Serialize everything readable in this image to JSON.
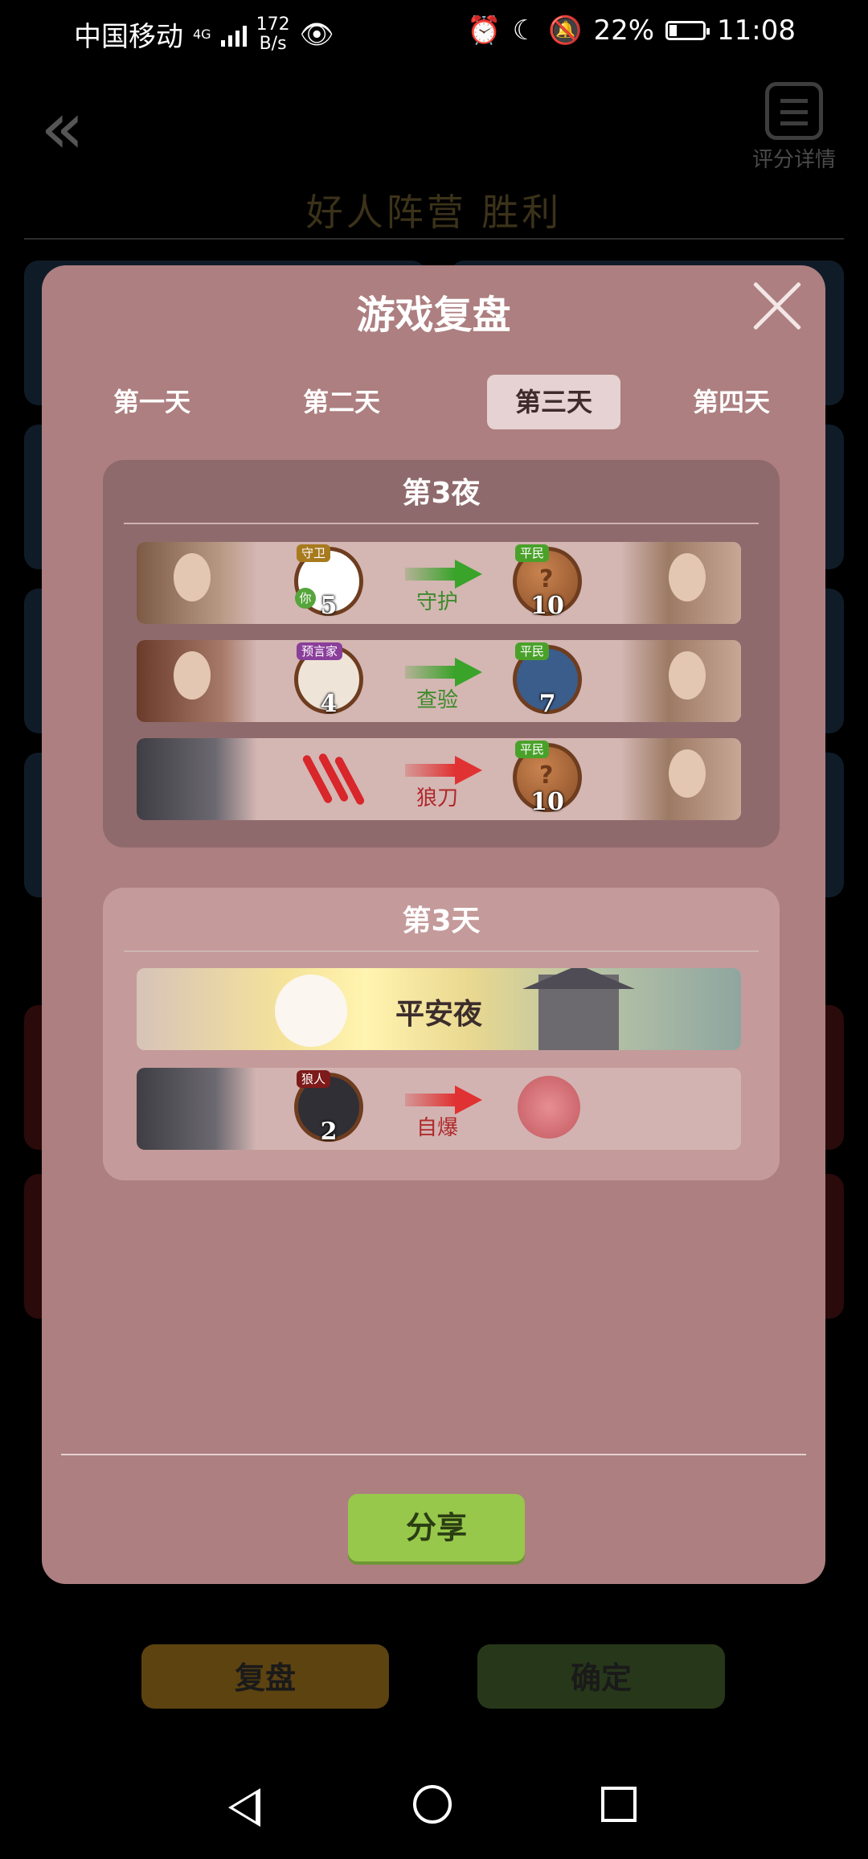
{
  "status_bar": {
    "carrier": "中国移动",
    "network": "4G",
    "speed_value": "172",
    "speed_unit": "B/s",
    "battery": "22%",
    "time": "11:08",
    "battery_fraction": 0.22
  },
  "background": {
    "result_title": "好人阵营  胜利",
    "score_detail_label": "评分详情",
    "review_button": "复盘",
    "confirm_button": "确定"
  },
  "modal": {
    "title": "游戏复盘",
    "tabs": [
      "第一天",
      "第二天",
      "第三天",
      "第四天"
    ],
    "active_tab": 2,
    "night": {
      "title": "第3夜",
      "rows": [
        {
          "actor_role": "守卫",
          "actor_num": "5",
          "actor_you": "你",
          "action": "守护",
          "target_role": "平民",
          "target_num": "10"
        },
        {
          "actor_role": "预言家",
          "actor_num": "4",
          "action": "查验",
          "target_role": "平民",
          "target_num": "7"
        },
        {
          "action": "狼刀",
          "target_role": "平民",
          "target_num": "10"
        }
      ]
    },
    "day": {
      "title": "第3天",
      "peace_text": "平安夜",
      "selfdestruct": {
        "actor_role": "狼人",
        "actor_num": "2",
        "action": "自爆"
      }
    },
    "share_button": "分享"
  },
  "colors": {
    "modal_bg": "#ad7f80",
    "active_tab_bg": "#e6d2d2",
    "share_btn": "#97c84b",
    "arrow_green": "#3aa32a",
    "arrow_red": "#e03232"
  }
}
